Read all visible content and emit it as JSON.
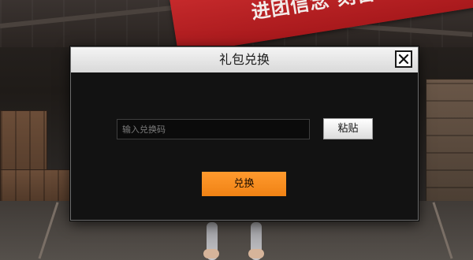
{
  "background": {
    "banner_text": "进团信念 刻苦训练 磨砺成才"
  },
  "dialog": {
    "title": "礼包兑换",
    "close_icon": "close-icon",
    "input": {
      "value": "",
      "placeholder": "输入兑换码"
    },
    "paste_label": "粘贴",
    "redeem_label": "兑换"
  },
  "colors": {
    "accent": "#f7901e",
    "dialog_bg": "#121212",
    "header_bg": "#e6e6e6",
    "banner": "#b82024"
  }
}
